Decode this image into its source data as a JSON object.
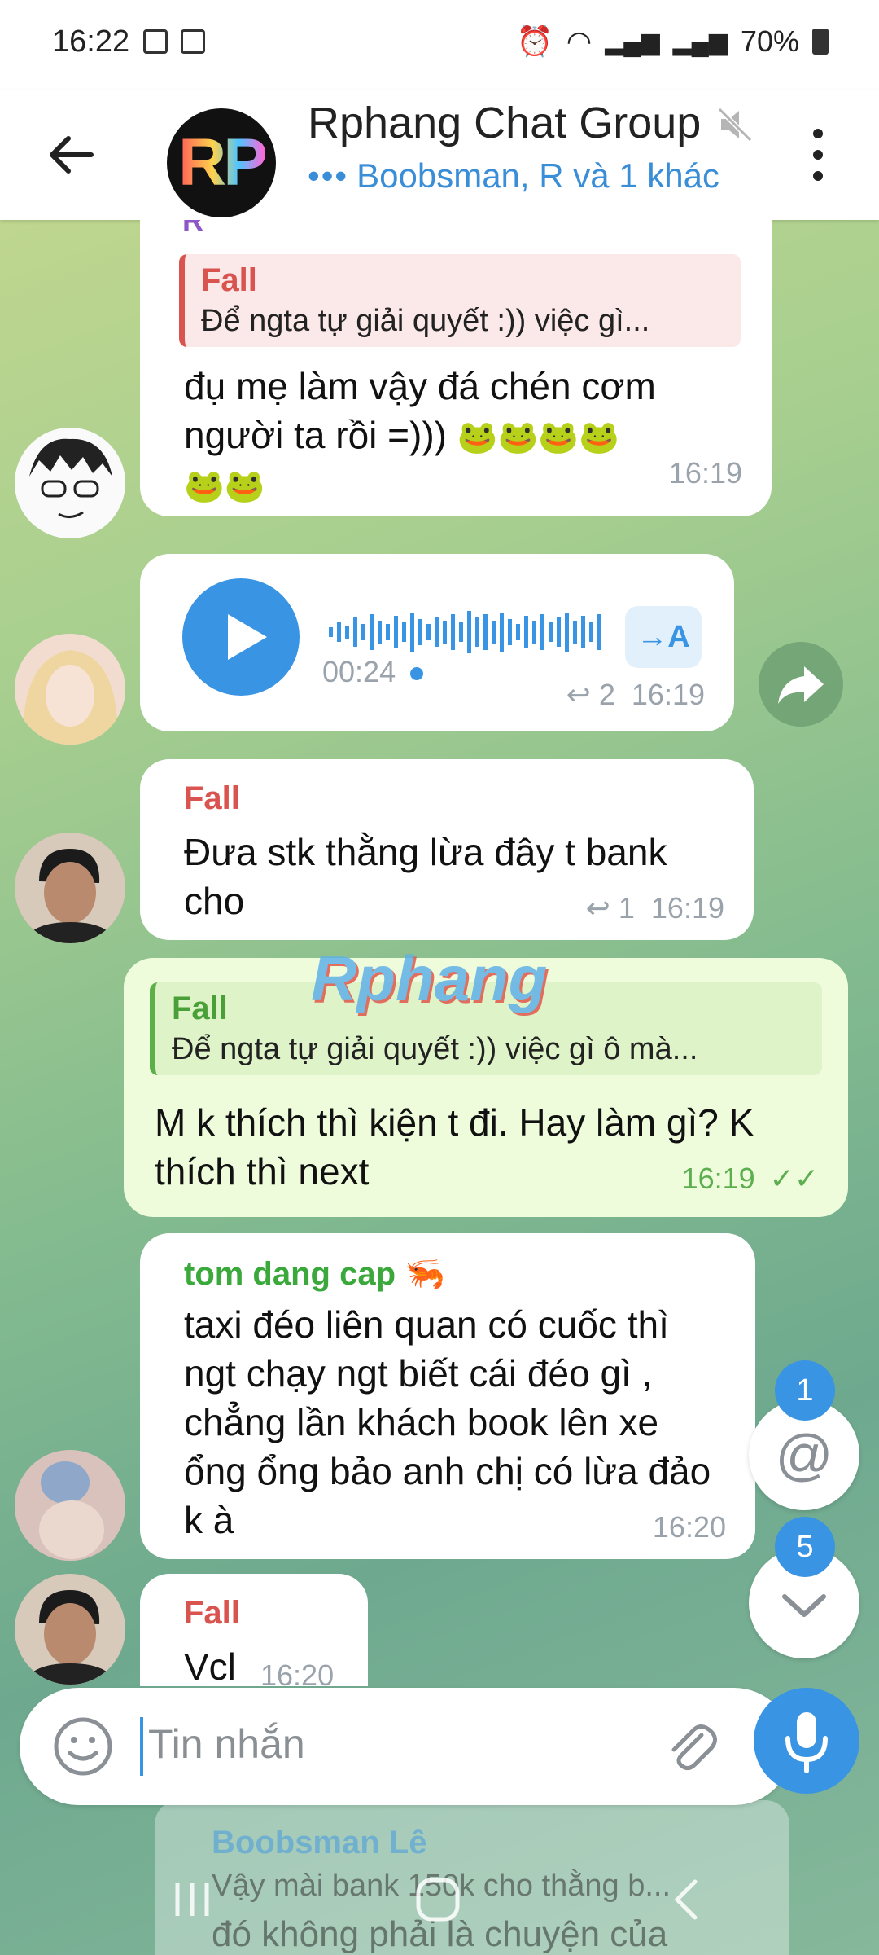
{
  "status": {
    "time": "16:22",
    "battery": "70%"
  },
  "header": {
    "title": "Rphang Chat Group",
    "subtitle": "Boobsman, R và 1 khác",
    "typing_dots": "•••",
    "avatar_text": "RP"
  },
  "messages": {
    "m1": {
      "sender_partial": "R",
      "quote_name": "Fall",
      "quote_text": "Để ngta tự giải quyết :)) việc gì...",
      "text_line1": "đụ mẹ làm vậy đá chén cơm",
      "text_line2": "người ta rồi =)))",
      "time": "16:19"
    },
    "m2": {
      "duration": "00:24",
      "transcribe_label": "→A",
      "reply_count": "2",
      "time": "16:19"
    },
    "m3": {
      "sender": "Fall",
      "text": "Đưa stk thằng lừa đây t bank cho",
      "reply_count": "1",
      "time": "16:19"
    },
    "m4": {
      "quote_name": "Fall",
      "quote_text": "Để ngta tự giải quyết :)) việc gì ô mà...",
      "text": "M k thích thì kiện t đi. Hay làm gì? K thích thì next",
      "time": "16:19",
      "watermark": "Rphang"
    },
    "m5": {
      "sender": "tom dang cap",
      "text": "taxi đéo liên quan có cuốc thì ngt chạy ngt biết cái đéo gì , chẳng lần khách book lên xe ổng ổng bảo anh chị có lừa đảo k à",
      "time": "16:20"
    },
    "m6": {
      "sender": "Fall",
      "text": "Vcl",
      "time": "16:20"
    },
    "m7": {
      "quote_name": "Boobsman Lê",
      "quote_text": "Vậy mài bank 150k cho thằng b...",
      "text": "đó không phải là chuyện của"
    }
  },
  "fabs": {
    "mention_badge": "1",
    "scroll_badge": "5"
  },
  "input": {
    "placeholder": "Tin nhắn"
  },
  "colors": {
    "accent": "#3994e4",
    "fall_name": "#d9534f",
    "tom_name": "#3aa83a",
    "quote_green": "#5bb048",
    "quote_blue": "#5aa6d8"
  }
}
